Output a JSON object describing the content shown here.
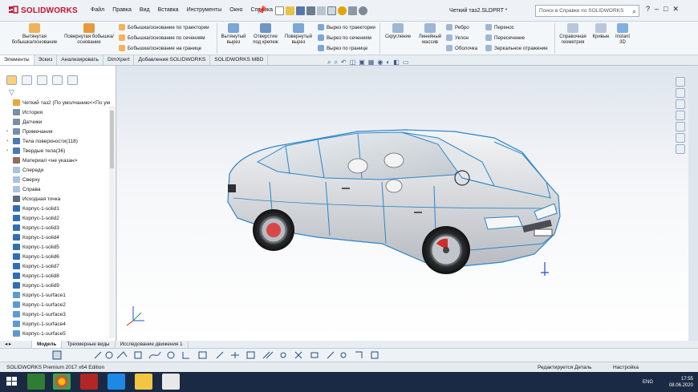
{
  "app": {
    "brand": "SOLIDWORKS",
    "doc_title": "Четкий таз2.SLDPRT *"
  },
  "menu": [
    "Файл",
    "Правка",
    "Вид",
    "Вставка",
    "Инструменты",
    "Окно",
    "Справка"
  ],
  "help_search": {
    "placeholder": "Поиск в Справке по SOLIDWORKS",
    "help": "?",
    "minimize": "–",
    "maximize": "□",
    "close": "✕"
  },
  "ribbon": {
    "extrude_boss": "Вытянутая бобышка/основание",
    "revolve_boss": "Повернутая бобышка/основание",
    "sweep_boss": "Бобышка/основание по траектории",
    "loft_boss": "Бобышка/основание по сечениям",
    "boundary_boss": "Бобышка/основание на границе",
    "extrude_cut": "Вытянутый вырез",
    "hole_wizard": "Отверстие под крепеж",
    "revolve_cut": "Повернутый вырез",
    "sweep_cut": "Вырез по траектории",
    "loft_cut": "Вырез по сечениям",
    "boundary_cut": "Вырез по границе",
    "fillet": "Скругление",
    "linear_pattern": "Линейный массив",
    "rib": "Ребро",
    "draft": "Уклон",
    "shell": "Оболочка",
    "wrap": "Перенос",
    "intersect": "Пересечение",
    "mirror": "Зеркальное отражение",
    "ref_geometry": "Справочная геометрия",
    "curves": "Кривые",
    "instant3d": "Instant 3D"
  },
  "tabs": [
    "Элементы",
    "Эскиз",
    "Анализировать",
    "DimXpert",
    "Добавления SOLIDWORKS",
    "SOLIDWORKS MBD"
  ],
  "active_tab": "Элементы",
  "tree": [
    {
      "label": "Четкий таз2  (По умолчанию<<По ум",
      "expand": "",
      "color": "#e8a73a"
    },
    {
      "label": "История",
      "expand": "",
      "color": "#7a8ea6"
    },
    {
      "label": "Датчики",
      "expand": "",
      "color": "#7a8ea6"
    },
    {
      "label": "Примечания",
      "expand": "›",
      "color": "#7a8ea6"
    },
    {
      "label": "Тела поверхности(118)",
      "expand": "›",
      "color": "#4a79b8"
    },
    {
      "label": "Твердые тела(36)",
      "expand": "›",
      "color": "#4a79b8"
    },
    {
      "label": "Материал <не указан>",
      "expand": "",
      "color": "#8d6e63"
    },
    {
      "label": "Спереди",
      "expand": "",
      "color": "#a8c4e0"
    },
    {
      "label": "Сверху",
      "expand": "",
      "color": "#a8c4e0"
    },
    {
      "label": "Справа",
      "expand": "",
      "color": "#a8c4e0"
    },
    {
      "label": "Исходная точка",
      "expand": "",
      "color": "#5d6b7a"
    },
    {
      "label": "Корпус-1-solid1",
      "expand": "",
      "color": "#2f6fb5"
    },
    {
      "label": "Корпус-1-solid2",
      "expand": "",
      "color": "#2f6fb5"
    },
    {
      "label": "Корпус-1-solid3",
      "expand": "",
      "color": "#2f6fb5"
    },
    {
      "label": "Корпус-1-solid4",
      "expand": "",
      "color": "#2f6fb5"
    },
    {
      "label": "Корпус-1-solid5",
      "expand": "",
      "color": "#2f6fb5"
    },
    {
      "label": "Корпус-1-solid6",
      "expand": "",
      "color": "#2f6fb5"
    },
    {
      "label": "Корпус-1-solid7",
      "expand": "",
      "color": "#2f6fb5"
    },
    {
      "label": "Корпус-1-solid8",
      "expand": "",
      "color": "#2f6fb5"
    },
    {
      "label": "Корпус-1-solid9",
      "expand": "",
      "color": "#2f6fb5"
    },
    {
      "label": "Корпус-1-surface1",
      "expand": "",
      "color": "#5b9bd5"
    },
    {
      "label": "Корпус-1-surface2",
      "expand": "",
      "color": "#5b9bd5"
    },
    {
      "label": "Корпус-1-surface3",
      "expand": "",
      "color": "#5b9bd5"
    },
    {
      "label": "Корпус-1-surface4",
      "expand": "",
      "color": "#5b9bd5"
    },
    {
      "label": "Корпус-1-surface5",
      "expand": "",
      "color": "#5b9bd5"
    }
  ],
  "bottom_tabs": [
    "Модель",
    "Трехмерные виды",
    "Исследование движения 1"
  ],
  "status": {
    "edition": "SOLIDWORKS Premium 2017 x64 Edition",
    "detail": "Редактируется Деталь",
    "settings": "Настройка"
  },
  "tray": {
    "lang": "ENG",
    "time": "17:55",
    "date": "08.06.2020"
  }
}
